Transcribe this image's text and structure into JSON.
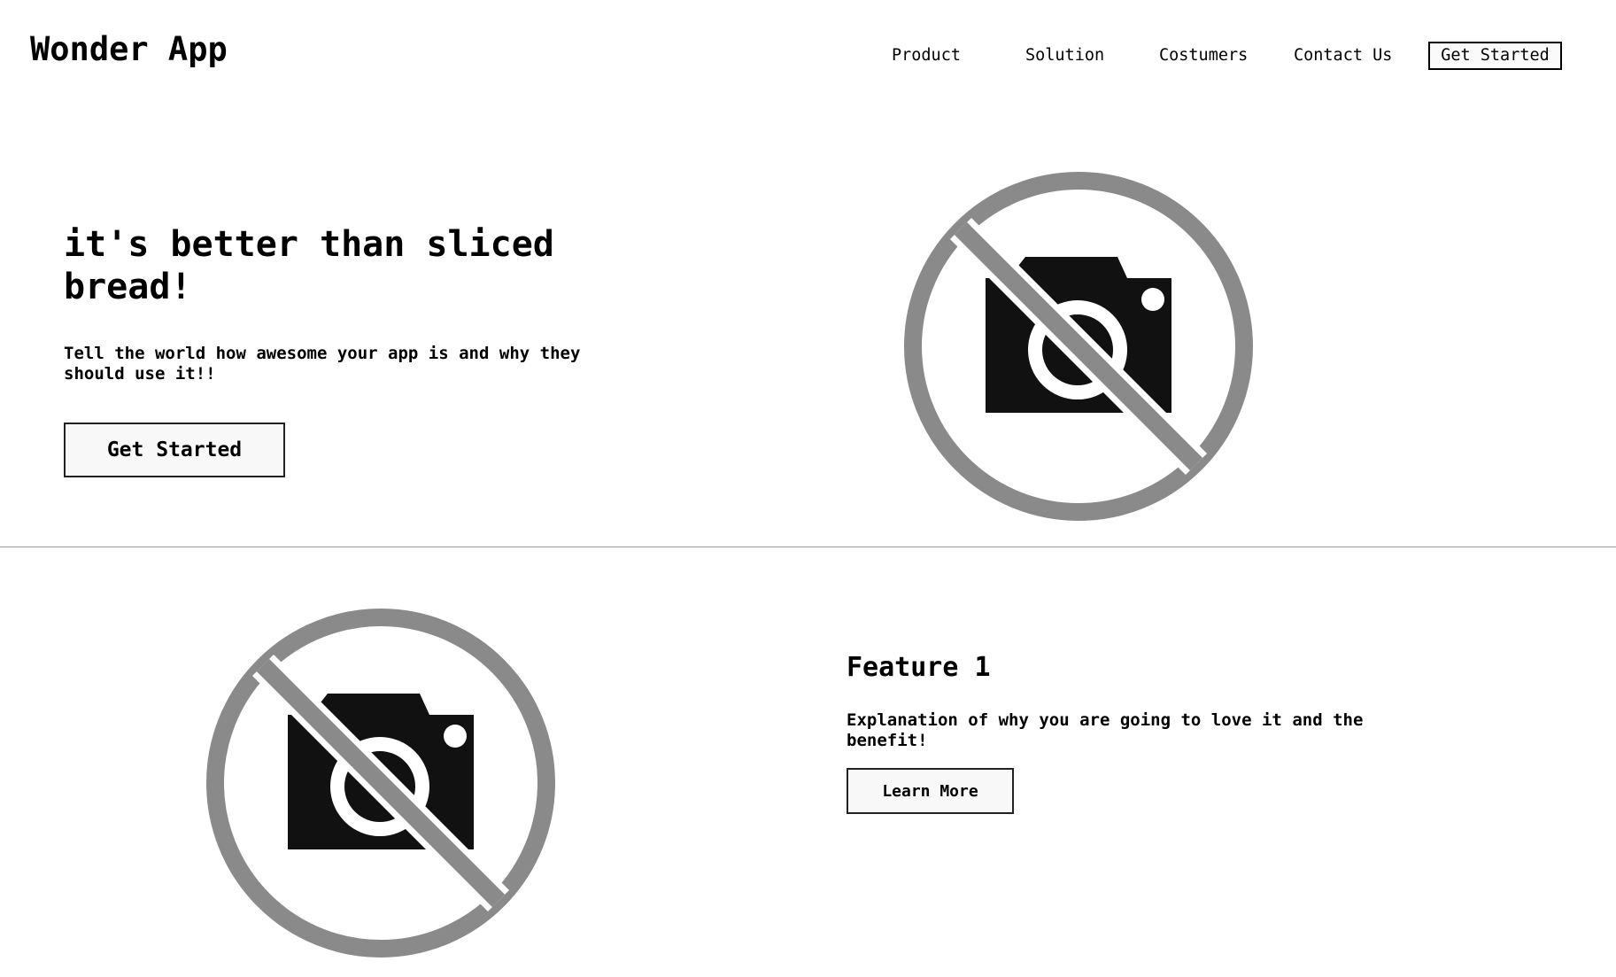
{
  "header": {
    "logo": "Wonder App",
    "nav": [
      "Product",
      "Solution",
      "Costumers",
      "Contact Us"
    ],
    "cta_label": "Get Started"
  },
  "hero": {
    "title": "it's better than sliced bread!",
    "subtitle": "Tell the world how awesome your app is and why they should use it!!",
    "button_label": "Get Started",
    "image_icon": "no-camera-icon"
  },
  "feature": {
    "title": "Feature 1",
    "description": "Explanation of why you are going to love it and the benefit!",
    "button_label": "Learn More",
    "image_icon": "no-camera-icon"
  },
  "colors": {
    "icon_ring": "#8a8a8a",
    "icon_camera": "#111111",
    "divider": "#999999"
  }
}
